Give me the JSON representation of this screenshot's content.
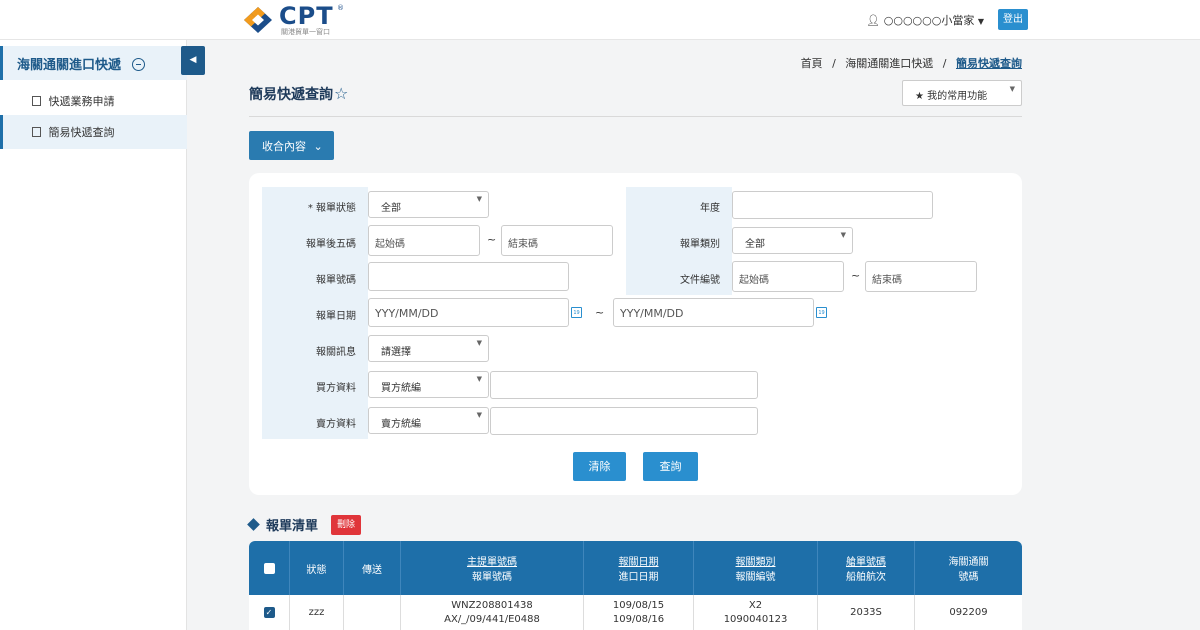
{
  "app": {
    "logo_text": "CPT",
    "logo_reg": "®",
    "logo_sub": "關港貿單一窗口",
    "user_label": "○○○○○○小當家",
    "logout_label": "登出"
  },
  "sidebar": {
    "heading": "海關通關進口快遞",
    "items": [
      {
        "label": "快遞業務申請"
      },
      {
        "label": "簡易快遞查詢"
      }
    ]
  },
  "breadcrumb": {
    "home": "首頁",
    "sep": "/",
    "middle": "海關通關進口快遞",
    "current": "簡易快遞查詢"
  },
  "page": {
    "title": "簡易快遞查詢",
    "favorites_label": "我的常用功能",
    "collapse_label": "收合內容"
  },
  "form": {
    "status_label": "* 報單狀態",
    "status_value": "全部",
    "year_label": "年度",
    "last5_label": "報單後五碼",
    "start_placeholder": "起始碼",
    "end_placeholder": "結束碼",
    "tilde": "~",
    "type_label": "報單類別",
    "type_value": "全部",
    "number_label": "報單號碼",
    "docno_label": "文件編號",
    "date_label": "報單日期",
    "date_placeholder": "YYY/MM/DD",
    "message_label": "報關訊息",
    "message_value": "請選擇",
    "buyer_label": "買方資料",
    "buyer_value": "買方統編",
    "seller_label": "賣方資料",
    "seller_value": "賣方統編",
    "clear_label": "清除",
    "search_label": "查詢"
  },
  "list": {
    "title": "報單清單",
    "delete_label": "刪除",
    "headers": {
      "status": "狀態",
      "send": "傳送",
      "master_1": "主提單號碼",
      "master_2": "報單號碼",
      "date_1": "報關日期",
      "date_2": "進口日期",
      "type_1": "報關類別",
      "type_2": "報關編號",
      "vessel_1": "艙單號碼",
      "vessel_2": "船舶航次",
      "customs_1": "海關通關",
      "customs_2": "號碼"
    },
    "rows": [
      {
        "checked": true,
        "status": "zzz",
        "send": "",
        "master": "WNZ208801438",
        "declaration": "AX/_/09/441/E0488",
        "report_date": "109/08/15",
        "import_date": "109/08/16",
        "type": "X2",
        "type_no": "1090040123",
        "vessel": "2033S",
        "customs_no": "092209"
      }
    ]
  }
}
